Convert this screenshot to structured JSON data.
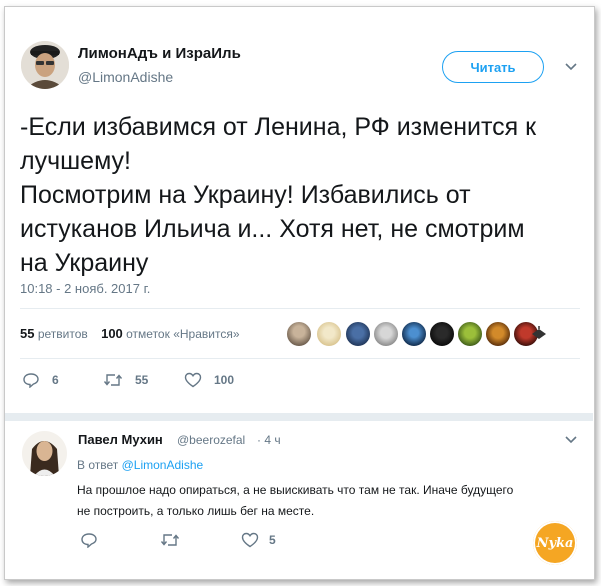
{
  "tweet": {
    "author_name": "ЛимонАдъ и ИзраИль",
    "author_handle": "@LimonAdishe",
    "follow_label": "Читать",
    "text_lines": [
      "-Если избавимся от Ленина, РФ изменится к",
      "лучшему!",
      "Посмотрим на Украину! Избавились от",
      "истуканов Ильича и... Хотя нет, не смотрим",
      "на Украину"
    ],
    "timestamp": "10:18 - 2 нояб. 2017 г.",
    "retweets_count": "55",
    "retweets_label": "ретвитов",
    "likes_count": "100",
    "likes_label": "отметок «Нравится»",
    "actions": {
      "reply_count": "6",
      "retweet_count": "55",
      "like_count": "100"
    }
  },
  "reply": {
    "author_name": "Павел Мухин",
    "author_handle": "@beerozefal",
    "age": "· 4 ч",
    "in_reply_to_prefix": "В ответ",
    "in_reply_to_handle": "@LimonAdishe",
    "text_lines": [
      "На прошлое надо опираться, а не выискивать что там не так. Иначе будущего",
      "не построить, а только лишь бег на месте."
    ],
    "actions": {
      "like_count": "5"
    }
  },
  "watermark": "Nyka",
  "colors": {
    "accent": "#1da1f2",
    "muted": "#657786",
    "text": "#14171a",
    "divider": "#e6ecf0"
  }
}
